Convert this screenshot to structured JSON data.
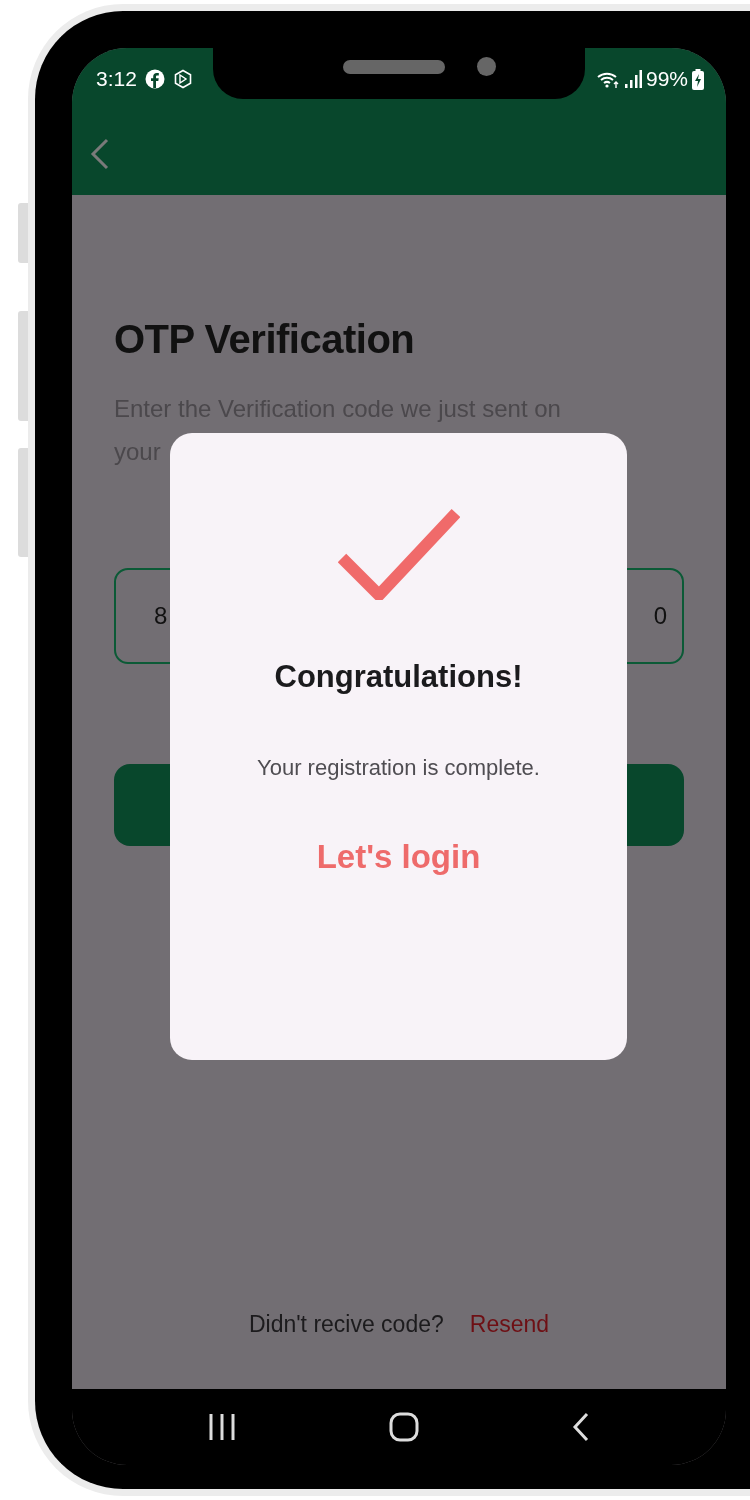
{
  "status_bar": {
    "time": "3:12",
    "battery": "99%"
  },
  "page": {
    "title": "OTP Verification",
    "subtitle_lines": [
      "Enter the Verification code we just sent on",
      "your"
    ],
    "otp_digits": [
      "8",
      "0"
    ],
    "resend_prompt": "Didn't recive code?",
    "resend_link": "Resend"
  },
  "dialog": {
    "title": "Congratulations!",
    "message": "Your registration is complete.",
    "action": "Let's login"
  }
}
